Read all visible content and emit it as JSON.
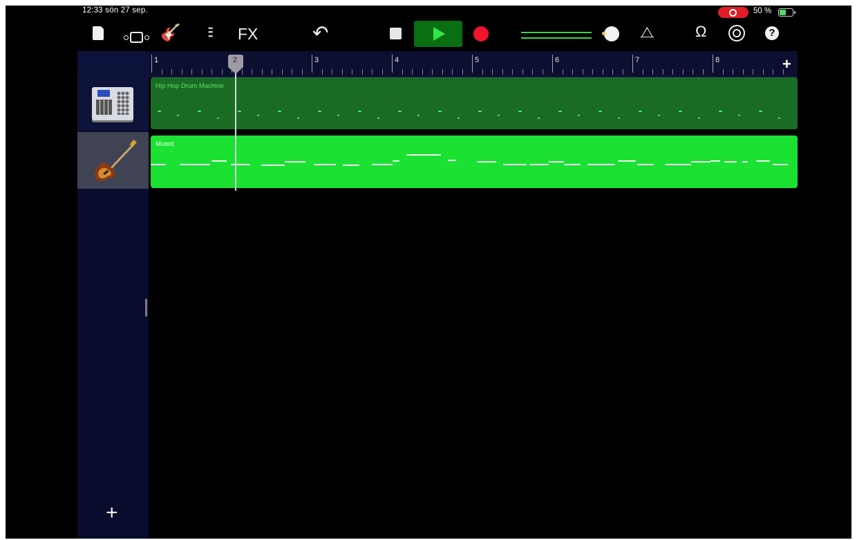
{
  "status_bar": {
    "time_date": "12:33  sön 27 sep.",
    "battery": "50 %",
    "recording_indicator": true
  },
  "toolbar": {
    "fx_label": "FX",
    "help_label": "?",
    "icons": [
      "my-songs-icon",
      "browser-icon",
      "instrument-icon",
      "mixer-icon",
      "undo-icon",
      "stop-icon",
      "play-icon",
      "record-icon",
      "volume-slider",
      "metronome-icon",
      "loop-icon",
      "settings-icon",
      "help-icon"
    ]
  },
  "ruler": {
    "bars": [
      "1",
      "2",
      "3",
      "4",
      "5",
      "6",
      "7",
      "8"
    ],
    "playhead_label": "2",
    "add_label": "+"
  },
  "tracks": [
    {
      "name": "drum",
      "instrument_icon": "drum-machine-icon",
      "region_label": "Hip Hop Drum Machine"
    },
    {
      "name": "bass",
      "instrument_icon": "bass-guitar-icon",
      "region_label": "Muted"
    }
  ],
  "add_track_label": "+",
  "colors": {
    "drum_region": "#1a6c25",
    "bass_region": "#1ae132",
    "play_green": "#2ee84a",
    "record_red": "#f2142a",
    "sidebar": "#080d2e"
  }
}
